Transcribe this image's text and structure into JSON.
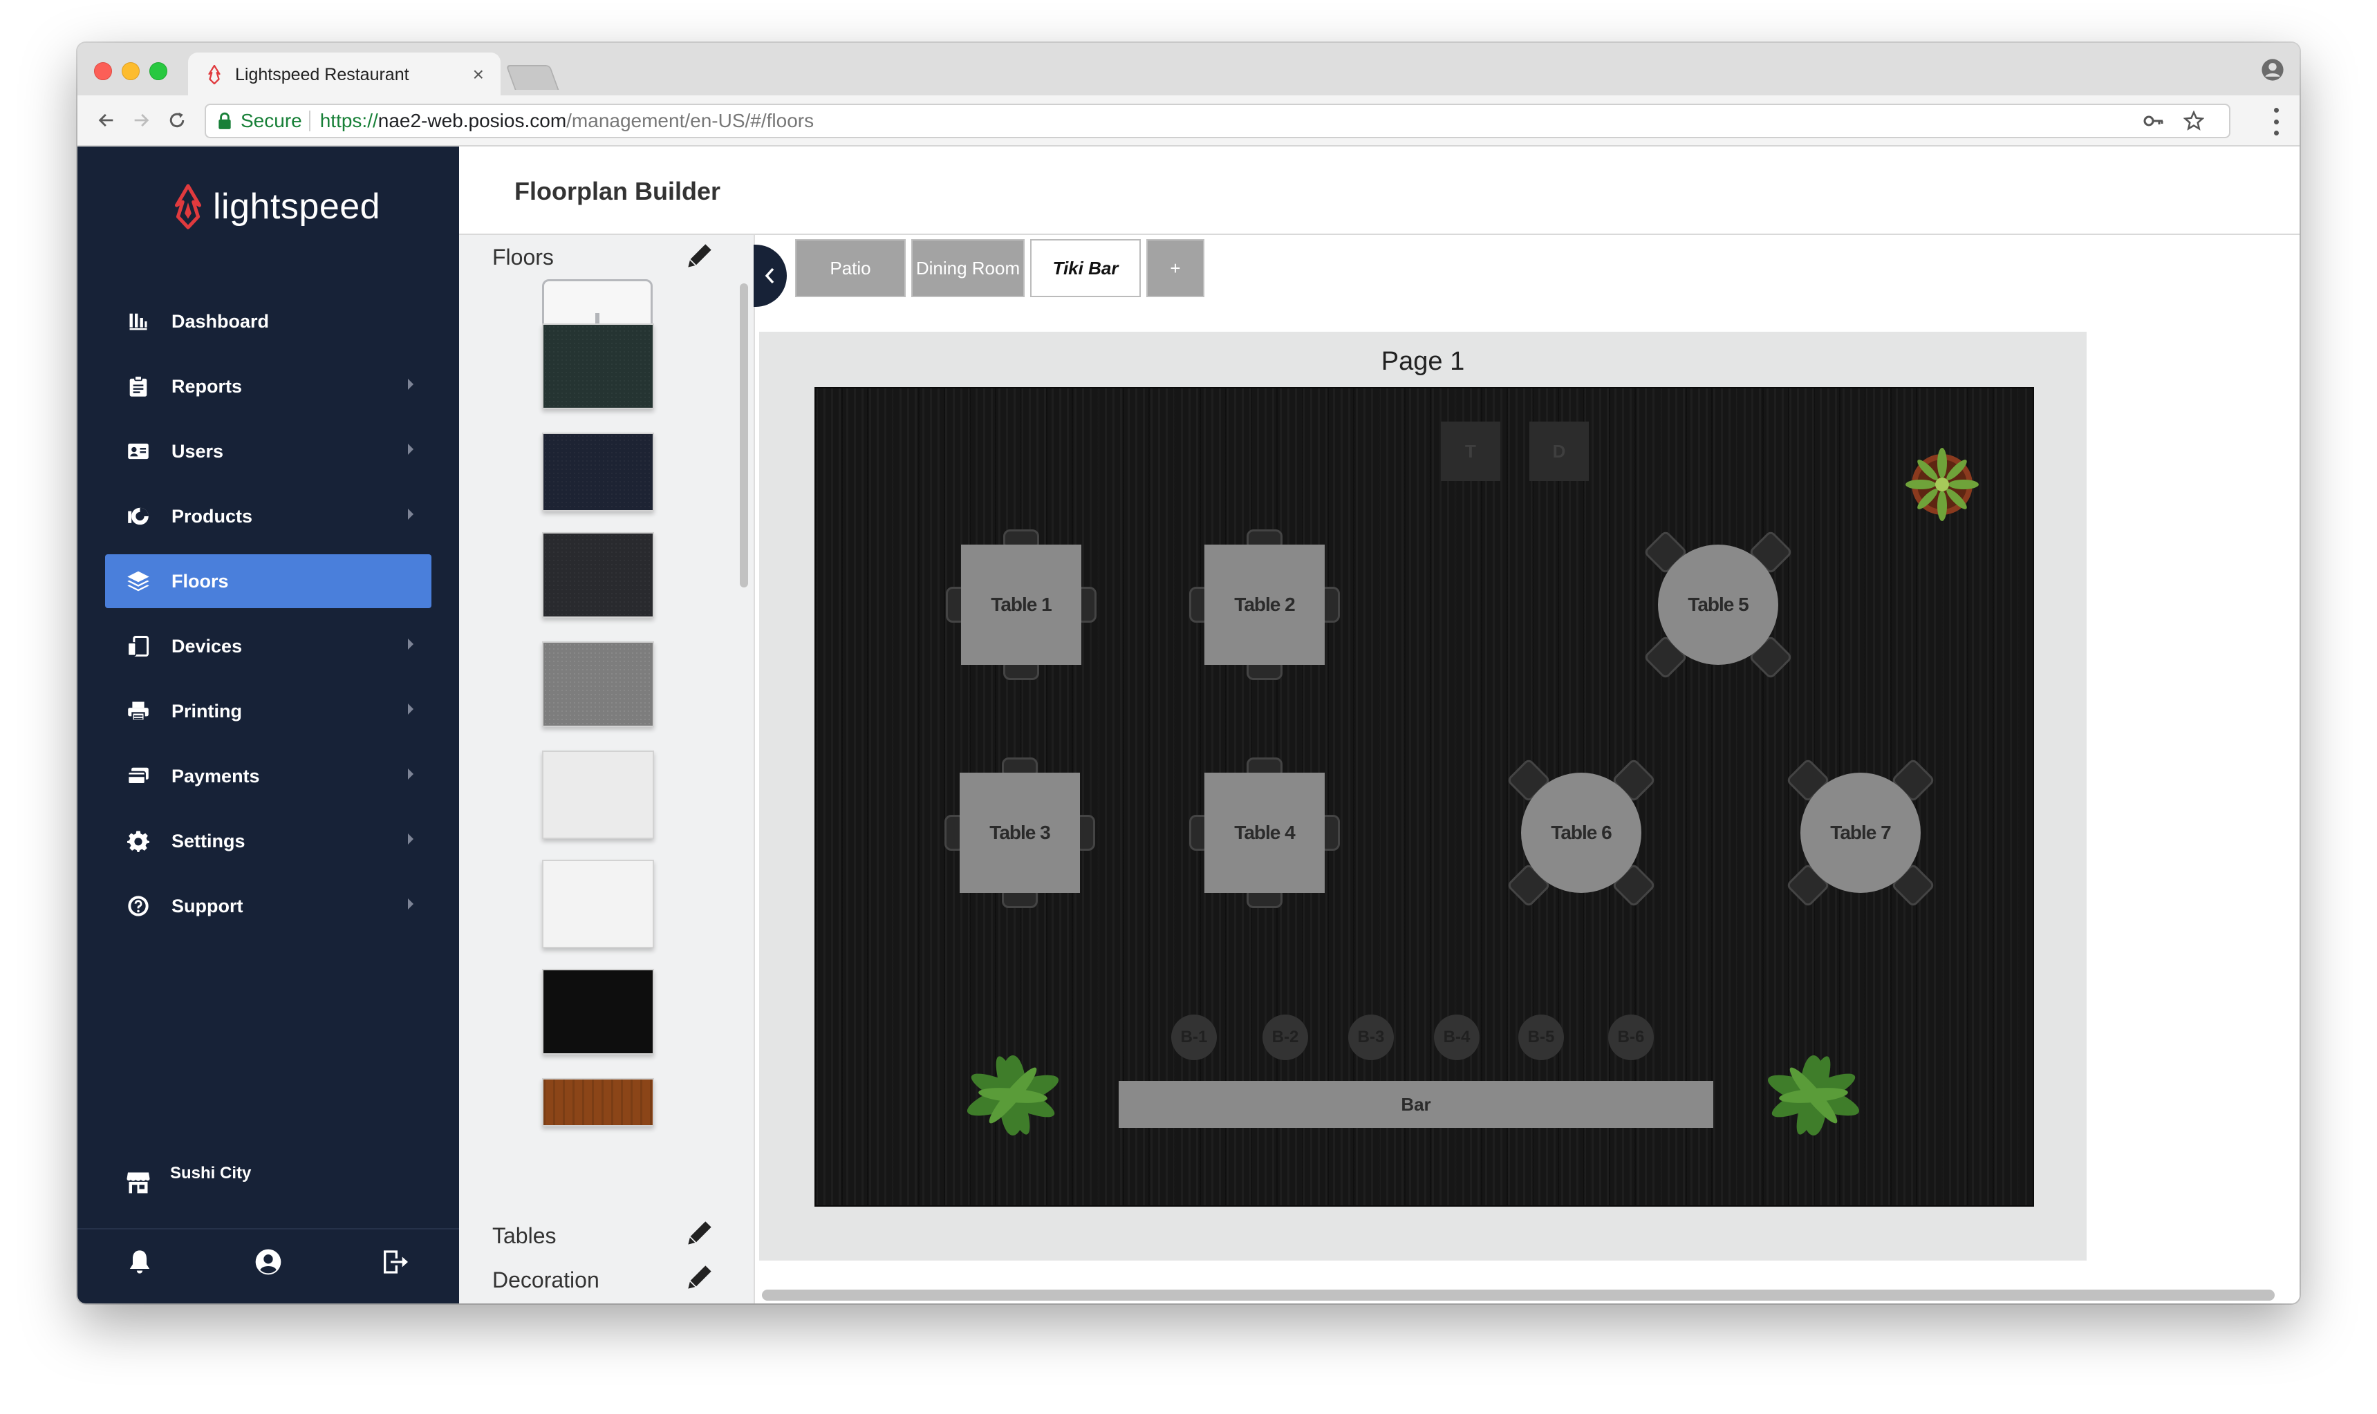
{
  "browser": {
    "tab_title": "Lightspeed Restaurant",
    "tab_close": "×",
    "secure_label": "Secure",
    "url_scheme": "https://",
    "url_host": "nae2-web.posios.com",
    "url_path": "/management/en-US/#/floors"
  },
  "sidebar": {
    "logo_text": "lightspeed",
    "items": [
      {
        "label": "Dashboard",
        "icon": "bar-chart-icon",
        "active": false,
        "has_submenu": false
      },
      {
        "label": "Reports",
        "icon": "clipboard-icon",
        "active": false,
        "has_submenu": true
      },
      {
        "label": "Users",
        "icon": "id-card-icon",
        "active": false,
        "has_submenu": true
      },
      {
        "label": "Products",
        "icon": "products-icon",
        "active": false,
        "has_submenu": true
      },
      {
        "label": "Floors",
        "icon": "layers-icon",
        "active": true,
        "has_submenu": false
      },
      {
        "label": "Devices",
        "icon": "devices-icon",
        "active": false,
        "has_submenu": true
      },
      {
        "label": "Printing",
        "icon": "printer-icon",
        "active": false,
        "has_submenu": true
      },
      {
        "label": "Payments",
        "icon": "credit-card-icon",
        "active": false,
        "has_submenu": true
      },
      {
        "label": "Settings",
        "icon": "gear-icon",
        "active": false,
        "has_submenu": true
      },
      {
        "label": "Support",
        "icon": "help-icon",
        "active": false,
        "has_submenu": true
      }
    ],
    "store_name": "Sushi City"
  },
  "page": {
    "title": "Floorplan Builder"
  },
  "panel": {
    "floors_title": "Floors",
    "tables_title": "Tables",
    "decoration_title": "Decoration",
    "swatch_colors": [
      "#253432",
      "#1d2333",
      "#292a2e",
      "#7d7d7d",
      "#ebebeb",
      "#f3f3f3",
      "#0e0e0e",
      "#8b4518"
    ]
  },
  "floor_tabs": [
    {
      "label": "Patio",
      "active": false
    },
    {
      "label": "Dining Room",
      "active": false
    },
    {
      "label": "Tiki Bar",
      "active": true
    },
    {
      "label": "+",
      "active": false
    }
  ],
  "canvas": {
    "page_label": "Page 1",
    "markers": [
      "T",
      "D"
    ],
    "tables": [
      {
        "label": "Table 1",
        "shape": "square"
      },
      {
        "label": "Table 2",
        "shape": "square"
      },
      {
        "label": "Table 5",
        "shape": "round"
      },
      {
        "label": "Table 3",
        "shape": "square"
      },
      {
        "label": "Table 4",
        "shape": "square"
      },
      {
        "label": "Table 6",
        "shape": "round"
      },
      {
        "label": "Table 7",
        "shape": "round"
      }
    ],
    "stools": [
      "B-1",
      "B-2",
      "B-3",
      "B-4",
      "B-5",
      "B-6"
    ],
    "bar_label": "Bar"
  }
}
